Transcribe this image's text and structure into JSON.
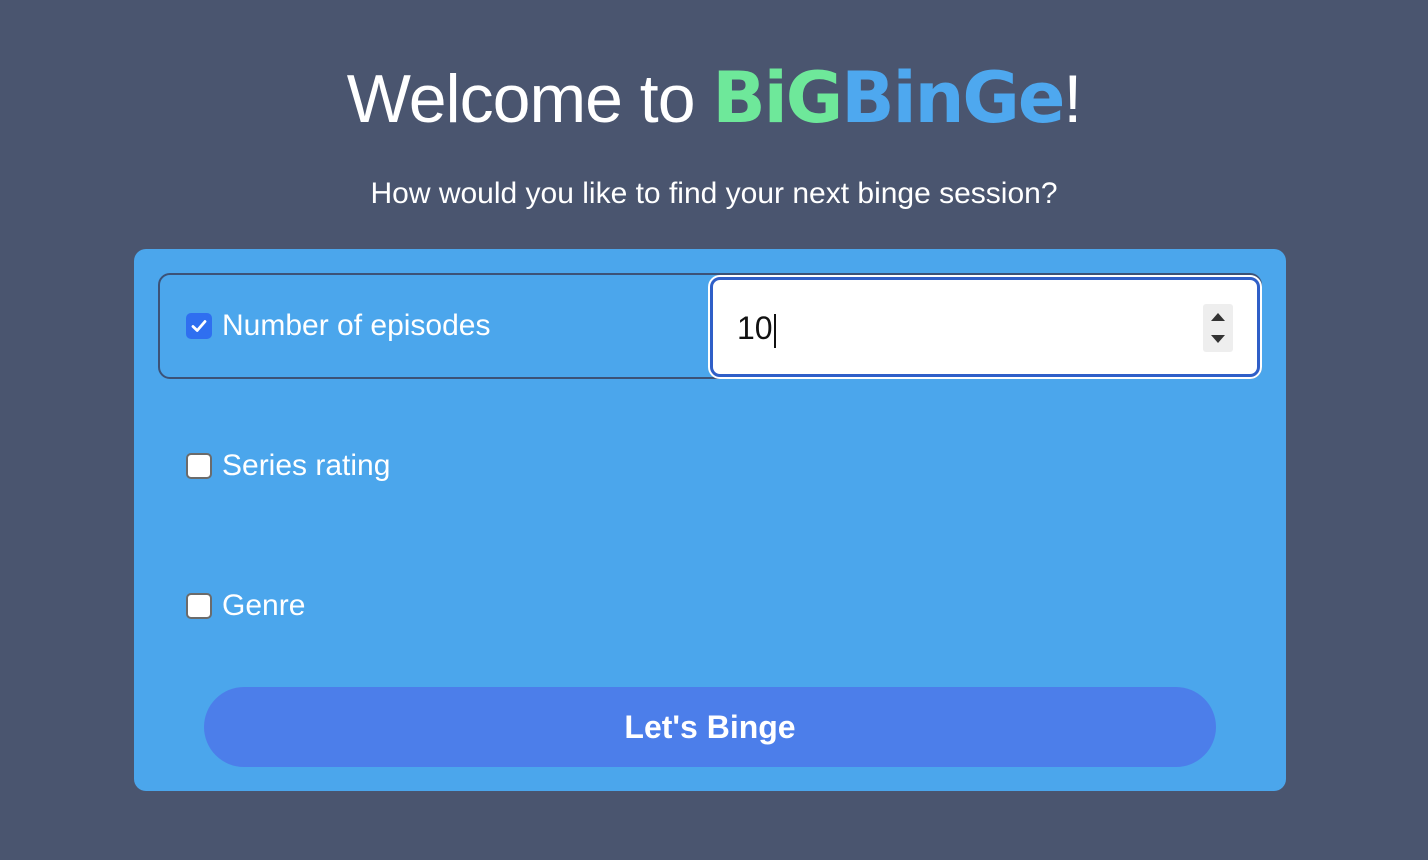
{
  "header": {
    "welcome_text": "Welcome to ",
    "logo_big": "BiG",
    "logo_binge": "BinGe",
    "exclamation": "!",
    "subtitle": "How would you like to find your next binge session?"
  },
  "options": [
    {
      "label": "Number of episodes",
      "checked": true,
      "input_value": "10"
    },
    {
      "label": "Series rating",
      "checked": false
    },
    {
      "label": "Genre",
      "checked": false
    }
  ],
  "submit": {
    "label": "Let's Binge"
  },
  "colors": {
    "background": "#4a556f",
    "card": "#4ba6ec",
    "logo_green": "#6ee89a",
    "logo_blue": "#4ea8ef",
    "button": "#4c7eea",
    "checkbox_checked": "#2f6ff0"
  }
}
